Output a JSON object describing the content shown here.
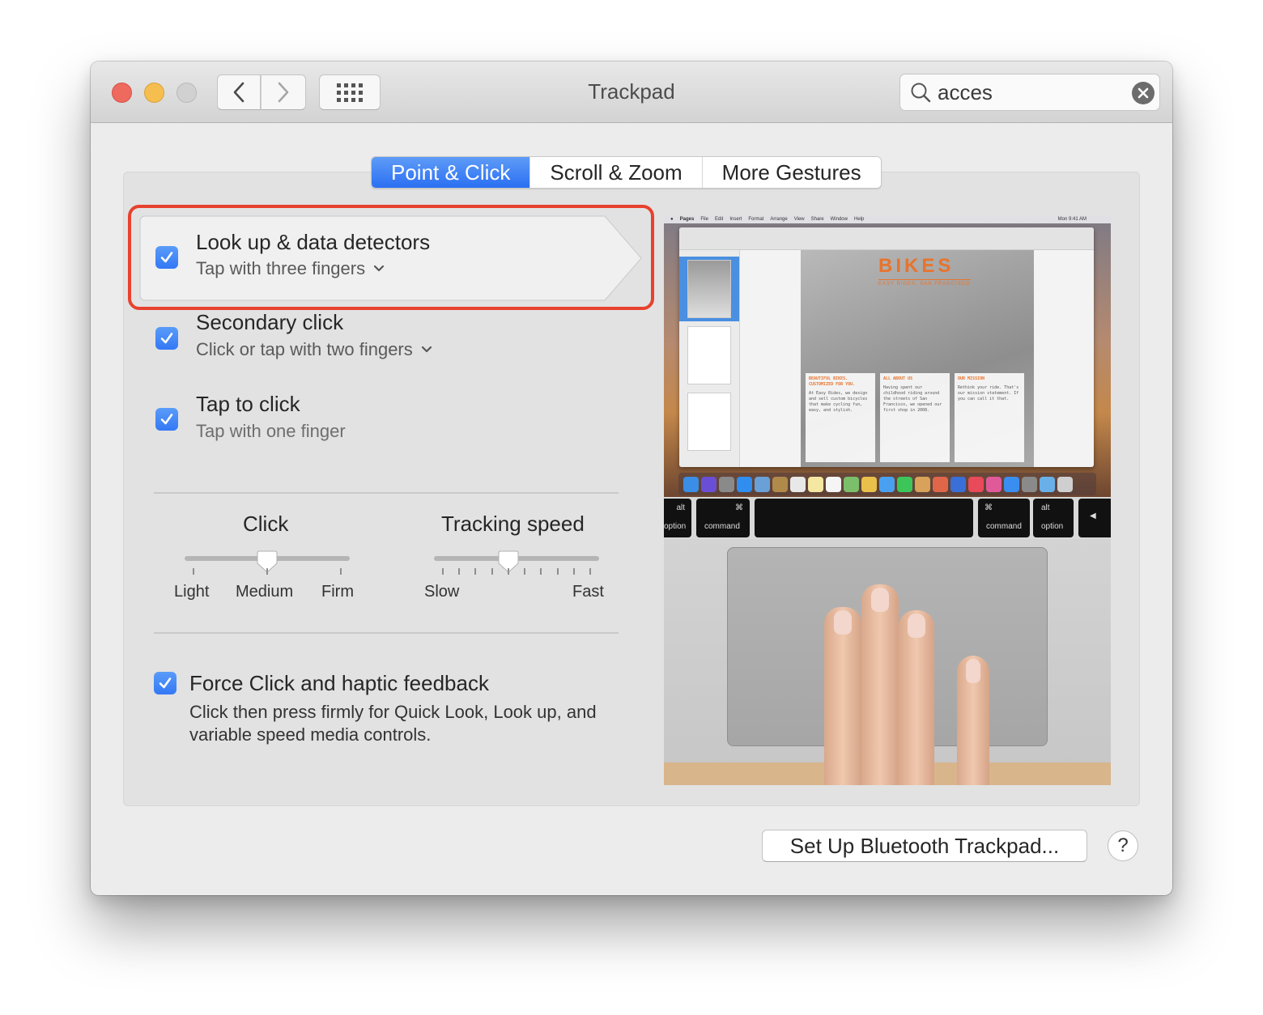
{
  "window": {
    "title": "Trackpad"
  },
  "toolbar": {
    "back_icon": "chevron-left-icon",
    "forward_icon": "chevron-right-icon",
    "show_all_icon": "grid-icon",
    "search": {
      "value": "acces",
      "placeholder": "Search",
      "icon": "search-icon",
      "clear_icon": "clear-icon"
    }
  },
  "tabs": [
    {
      "label": "Point & Click",
      "active": true
    },
    {
      "label": "Scroll & Zoom",
      "active": false
    },
    {
      "label": "More Gestures",
      "active": false
    }
  ],
  "options": [
    {
      "title": "Look up & data detectors",
      "subtitle": "Tap with three fingers",
      "has_dropdown": true,
      "checked": true,
      "highlighted": true
    },
    {
      "title": "Secondary click",
      "subtitle": "Click or tap with two fingers",
      "has_dropdown": true,
      "checked": true,
      "highlighted": false
    },
    {
      "title": "Tap to click",
      "subtitle": "Tap with one finger",
      "has_dropdown": false,
      "checked": true,
      "highlighted": false
    }
  ],
  "sliders": {
    "click": {
      "title": "Click",
      "labels": [
        "Light",
        "Medium",
        "Firm"
      ],
      "tick_count": 3,
      "value_index": 1
    },
    "tracking": {
      "title": "Tracking speed",
      "labels": [
        "Slow",
        "Fast"
      ],
      "tick_count": 10,
      "value_index": 4
    }
  },
  "force_click": {
    "title": "Force Click and haptic feedback",
    "description": "Click then press firmly for Quick Look, Look up, and variable speed media controls.",
    "checked": true
  },
  "preview": {
    "menubar_items": [
      "Pages",
      "File",
      "Edit",
      "Insert",
      "Format",
      "Arrange",
      "View",
      "Share",
      "Window",
      "Help"
    ],
    "menubar_clock": "Mon 9:41 AM",
    "doc_title": "BIKES",
    "doc_subtitle": "EASY RIDES, SAN FRANCISCO",
    "columns": [
      {
        "heading": "BEAUTIFUL BIKES. CUSTOMIZED FOR YOU.",
        "text": "At Easy Rides, we design and sell custom bicycles that make cycling fun, easy, and stylish."
      },
      {
        "heading": "ALL ABOUT US",
        "text": "Having spent our childhood riding around the streets of San Francisco, we opened our first shop in 2008."
      },
      {
        "heading": "OUR MISSION",
        "text": "Rethink your ride. That's our mission statement. If you can call it that."
      }
    ],
    "keys": [
      {
        "top": "alt",
        "bottom": "option"
      },
      {
        "top": "⌘",
        "bottom": "command"
      },
      {
        "top": "",
        "bottom": ""
      },
      {
        "top": "⌘",
        "bottom": "command"
      },
      {
        "top": "alt",
        "bottom": "option"
      },
      {
        "top": "◀",
        "bottom": ""
      }
    ]
  },
  "footer": {
    "setup_button": "Set Up Bluetooth Trackpad...",
    "help_button": "?"
  },
  "colors": {
    "accent": "#3478f6",
    "highlight_border": "#e8412e",
    "close": "#ee6a5f",
    "minimize": "#f5be4f",
    "zoom_disabled": "#d1d1d1"
  }
}
